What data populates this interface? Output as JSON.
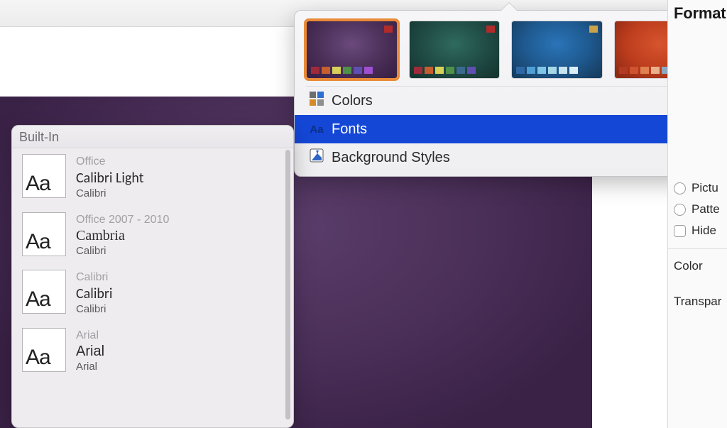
{
  "fonts_panel": {
    "header": "Built-In",
    "items": [
      {
        "caption": "Office",
        "heading": "Calibri Light",
        "body": "Calibri",
        "heading_family": "Calibri, Arial, sans-serif",
        "swatch_family": "'Helvetica Neue', Arial, sans-serif"
      },
      {
        "caption": "Office 2007 - 2010",
        "heading": "Cambria",
        "body": "Calibri",
        "heading_family": "Georgia, 'Times New Roman', serif",
        "swatch_family": "'Helvetica Neue', Arial, sans-serif"
      },
      {
        "caption": "Calibri",
        "heading": "Calibri",
        "body": "Calibri",
        "heading_family": "Calibri, Arial, sans-serif",
        "swatch_family": "'Helvetica Neue', Arial, sans-serif"
      },
      {
        "caption": "Arial",
        "heading": "Arial",
        "body": "Arial",
        "heading_family": "Arial, sans-serif",
        "swatch_family": "Arial, sans-serif"
      }
    ]
  },
  "theme_popover": {
    "thumbs": [
      {
        "bg": "radial-gradient(ellipse at 50% 40%, #6a4a7c 0%, #4a2f58 55%, #3a2146 90%)",
        "corner": "#b12b2b",
        "chips": [
          "#9f2b3a",
          "#c65f2e",
          "#d8d157",
          "#4f9148",
          "#5f4fb0",
          "#a04fcf"
        ]
      },
      {
        "bg": "radial-gradient(ellipse at 50% 40%, #2f6a5e 0%, #1f4a44 55%, #173732 90%)",
        "corner": "#b12b2b",
        "chips": [
          "#9f2b3a",
          "#c65f2e",
          "#d8d157",
          "#4f9148",
          "#3b6a8f",
          "#5f4fb0"
        ]
      },
      {
        "bg": "radial-gradient(ellipse at 50% 40%, #2a74b8 0%, #1f5a91 50%, #173f63 90%)",
        "corner": "#c9a24a",
        "chips": [
          "#2f67a4",
          "#4f9ed4",
          "#7fc5e6",
          "#a7d8e8",
          "#c7e4ef",
          "#dbeef5"
        ]
      },
      {
        "bg": "radial-gradient(ellipse at 50% 40%, #d7542d 0%, #bb3c1d 55%, #8f2a14 90%)",
        "corner": "#c9a24a",
        "chips": [
          "#b23a20",
          "#d0532f",
          "#e08050",
          "#e9b08a",
          "#8aa9c0",
          "#c6d6e2"
        ]
      }
    ],
    "selected_index": 0,
    "menu": {
      "colors": "Colors",
      "fonts": "Fonts",
      "bgstyles": "Background Styles"
    },
    "selected_menu": "fonts"
  },
  "format_panel": {
    "title": "Format",
    "fill_options": {
      "picture": "Pictu",
      "pattern": "Patte"
    },
    "hide_bg": "Hide ",
    "color_label": "Color",
    "transparency_label": "Transpar"
  }
}
